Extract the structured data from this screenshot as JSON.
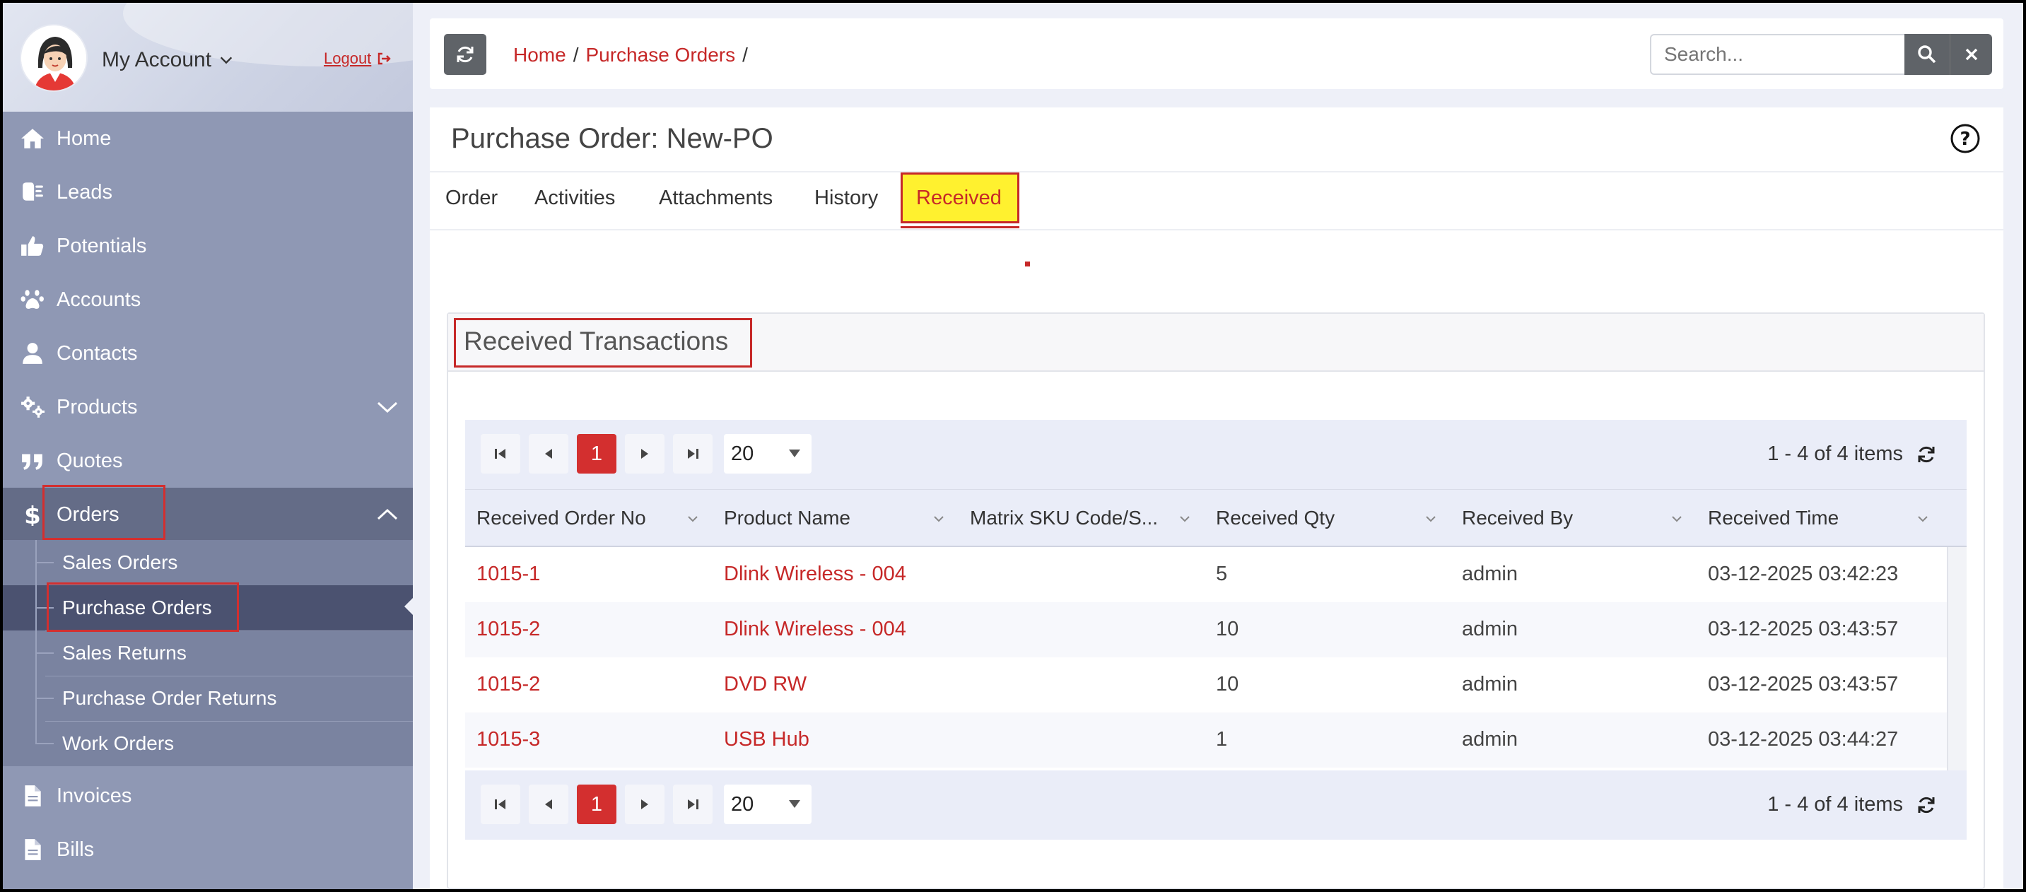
{
  "sidebar": {
    "account_label": "My Account",
    "logout_label": "Logout",
    "items": [
      {
        "label": "Home",
        "icon": "home-icon"
      },
      {
        "label": "Leads",
        "icon": "leads-icon"
      },
      {
        "label": "Potentials",
        "icon": "thumbs-up-icon"
      },
      {
        "label": "Accounts",
        "icon": "paw-icon"
      },
      {
        "label": "Contacts",
        "icon": "user-icon"
      },
      {
        "label": "Products",
        "icon": "gears-icon"
      },
      {
        "label": "Quotes",
        "icon": "quote-icon"
      },
      {
        "label": "Orders",
        "icon": "dollar-icon"
      },
      {
        "label": "Invoices",
        "icon": "document-icon"
      },
      {
        "label": "Bills",
        "icon": "document-icon"
      }
    ],
    "order_subitems": [
      "Sales Orders",
      "Purchase Orders",
      "Sales Returns",
      "Purchase Order Returns",
      "Work Orders"
    ],
    "active_subitem": "Purchase Orders"
  },
  "topbar": {
    "breadcrumb": [
      "Home",
      "Purchase Orders"
    ],
    "search_placeholder": "Search..."
  },
  "page": {
    "title": "Purchase Order: New-PO",
    "tabs": [
      "Order",
      "Activities",
      "Attachments",
      "History",
      "Received"
    ],
    "active_tab": "Received"
  },
  "panel": {
    "title": "Received Transactions"
  },
  "grid": {
    "current_page": "1",
    "page_size": "20",
    "info": "1 - 4 of 4 items",
    "columns": [
      "Received Order No",
      "Product Name",
      "Matrix SKU Code/S...",
      "Received Qty",
      "Received By",
      "Received Time"
    ],
    "rows": [
      {
        "order_no": "1015-1",
        "product": "Dlink Wireless - 004",
        "sku": "",
        "qty": "5",
        "by": "admin",
        "time": "03-12-2025 03:42:23"
      },
      {
        "order_no": "1015-2",
        "product": "Dlink Wireless - 004",
        "sku": "",
        "qty": "10",
        "by": "admin",
        "time": "03-12-2025 03:43:57"
      },
      {
        "order_no": "1015-2",
        "product": "DVD RW",
        "sku": "",
        "qty": "10",
        "by": "admin",
        "time": "03-12-2025 03:43:57"
      },
      {
        "order_no": "1015-3",
        "product": "USB Hub",
        "sku": "",
        "qty": "1",
        "by": "admin",
        "time": "03-12-2025 03:44:27"
      }
    ]
  },
  "colors": {
    "accent_red": "#c62828",
    "sidebar_bg": "#8f98b4",
    "highlight_yellow": "#fff12f"
  }
}
